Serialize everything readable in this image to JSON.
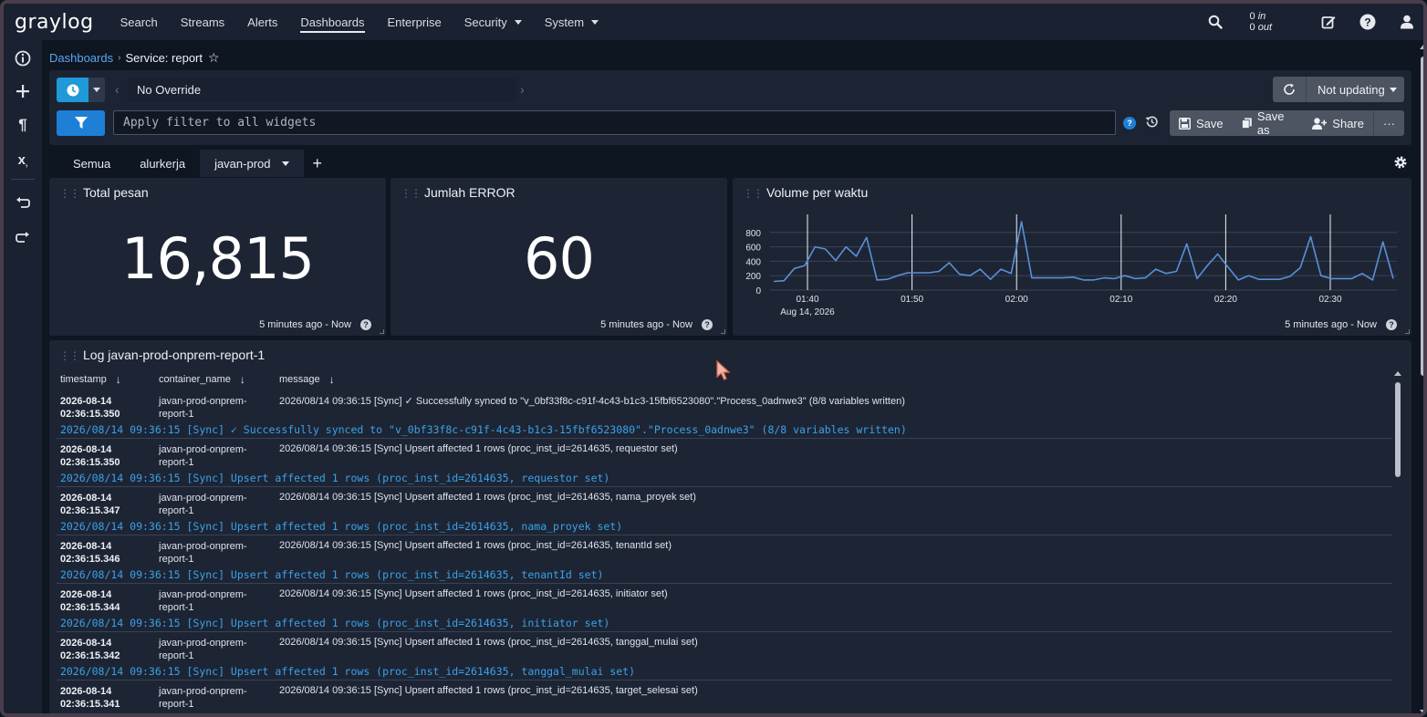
{
  "nav": {
    "logo": "graylog",
    "links": [
      "Search",
      "Streams",
      "Alerts",
      "Dashboards",
      "Enterprise",
      "Security",
      "System"
    ],
    "active": "Dashboards",
    "throughput_in": "0",
    "throughput_in_label": "in",
    "throughput_out": "0",
    "throughput_out_label": "out"
  },
  "breadcrumb": {
    "parent": "Dashboards",
    "current": "Service: report"
  },
  "query": {
    "range": "No Override",
    "filter_placeholder": "Apply filter to all widgets",
    "refresh_label": "Not updating",
    "save": "Save",
    "save_as": "Save as",
    "share": "Share",
    "more": "···"
  },
  "tabs": [
    "Semua",
    "alurkerja",
    "javan-prod"
  ],
  "active_tab": "javan-prod",
  "widgets": {
    "total": {
      "title": "Total pesan",
      "value": "16,815",
      "footer": "5 minutes ago - Now"
    },
    "errors": {
      "title": "Jumlah ERROR",
      "value": "60",
      "footer": "5 minutes ago - Now"
    },
    "volume": {
      "title": "Volume per waktu",
      "footer": "5 minutes ago - Now"
    }
  },
  "chart_data": {
    "type": "line",
    "title": "Volume per waktu",
    "x_ticks": [
      "01:40",
      "01:50",
      "02:00",
      "02:10",
      "02:20",
      "02:30"
    ],
    "x_date_label": "Aug 14, 2026",
    "y_ticks": [
      0,
      200,
      400,
      600,
      800
    ],
    "ylim": [
      0,
      1000
    ],
    "color": "#5b8fd6",
    "values": [
      120,
      130,
      300,
      340,
      600,
      570,
      410,
      600,
      470,
      730,
      140,
      150,
      200,
      240,
      240,
      240,
      260,
      380,
      220,
      200,
      290,
      150,
      290,
      230,
      950,
      170,
      170,
      170,
      170,
      180,
      140,
      140,
      170,
      160,
      200,
      160,
      170,
      290,
      230,
      260,
      640,
      160,
      340,
      500,
      320,
      140,
      200,
      150,
      150,
      150,
      190,
      310,
      740,
      200,
      160,
      160,
      160,
      230,
      140,
      670,
      160
    ]
  },
  "log": {
    "title": "Log javan-prod-onprem-report-1",
    "columns": [
      "timestamp",
      "container_name",
      "message"
    ],
    "rows": [
      {
        "ts1": "2026-08-14",
        "ts2": "02:36:15.350",
        "cn1": "javan-prod-onprem-",
        "cn2": "report-1",
        "msg": "2026/08/14 09:36:15 [Sync] ✓ Successfully synced to \"v_0bf33f8c-c91f-4c43-b1c3-15fbf6523080\".\"Process_0adnwe3\" (8/8 variables written)",
        "full": "2026/08/14 09:36:15 [Sync] ✓ Successfully synced to \"v_0bf33f8c-c91f-4c43-b1c3-15fbf6523080\".\"Process_0adnwe3\" (8/8 variables written)"
      },
      {
        "ts1": "2026-08-14",
        "ts2": "02:36:15.350",
        "cn1": "javan-prod-onprem-",
        "cn2": "report-1",
        "msg": "2026/08/14 09:36:15 [Sync] Upsert affected 1 rows (proc_inst_id=2614635, requestor set)",
        "full": "2026/08/14 09:36:15 [Sync] Upsert affected 1 rows (proc_inst_id=2614635, requestor set)"
      },
      {
        "ts1": "2026-08-14",
        "ts2": "02:36:15.347",
        "cn1": "javan-prod-onprem-",
        "cn2": "report-1",
        "msg": "2026/08/14 09:36:15 [Sync] Upsert affected 1 rows (proc_inst_id=2614635, nama_proyek set)",
        "full": "2026/08/14 09:36:15 [Sync] Upsert affected 1 rows (proc_inst_id=2614635, nama_proyek set)"
      },
      {
        "ts1": "2026-08-14",
        "ts2": "02:36:15.346",
        "cn1": "javan-prod-onprem-",
        "cn2": "report-1",
        "msg": "2026/08/14 09:36:15 [Sync] Upsert affected 1 rows (proc_inst_id=2614635, tenantId set)",
        "full": "2026/08/14 09:36:15 [Sync] Upsert affected 1 rows (proc_inst_id=2614635, tenantId set)"
      },
      {
        "ts1": "2026-08-14",
        "ts2": "02:36:15.344",
        "cn1": "javan-prod-onprem-",
        "cn2": "report-1",
        "msg": "2026/08/14 09:36:15 [Sync] Upsert affected 1 rows (proc_inst_id=2614635, initiator set)",
        "full": "2026/08/14 09:36:15 [Sync] Upsert affected 1 rows (proc_inst_id=2614635, initiator set)"
      },
      {
        "ts1": "2026-08-14",
        "ts2": "02:36:15.342",
        "cn1": "javan-prod-onprem-",
        "cn2": "report-1",
        "msg": "2026/08/14 09:36:15 [Sync] Upsert affected 1 rows (proc_inst_id=2614635, tanggal_mulai set)",
        "full": "2026/08/14 09:36:15 [Sync] Upsert affected 1 rows (proc_inst_id=2614635, tanggal_mulai set)"
      },
      {
        "ts1": "2026-08-14",
        "ts2": "02:36:15.341",
        "cn1": "javan-prod-onprem-",
        "cn2": "report-1",
        "msg": "2026/08/14 09:36:15 [Sync] Upsert affected 1 rows (proc_inst_id=2614635, target_selesai set)",
        "full": "2026/08/14 09:36:15 [Sync] Upsert affected 1 rows (proc_inst_id=2614635, target_selesai set)"
      }
    ]
  }
}
